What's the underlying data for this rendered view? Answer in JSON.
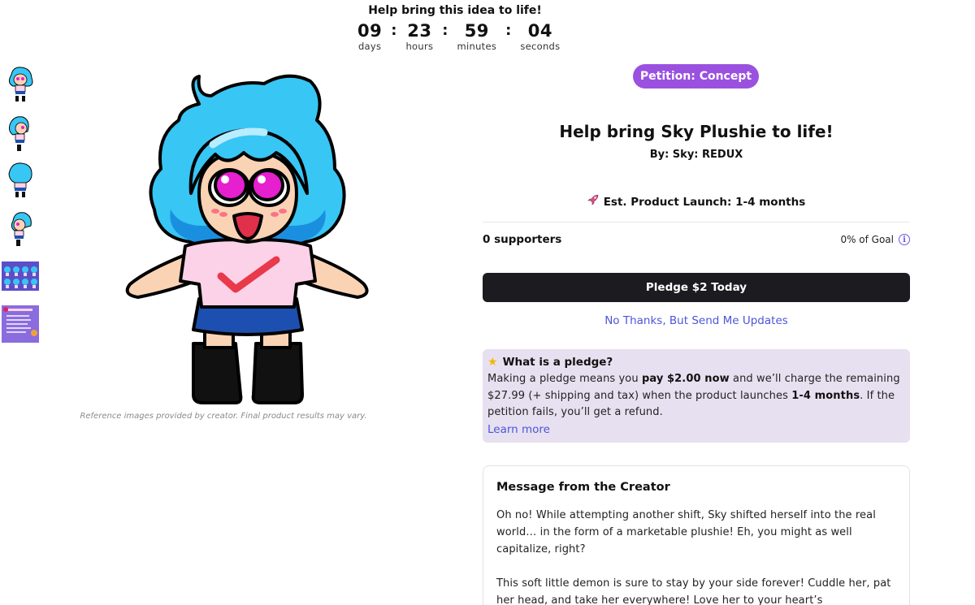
{
  "countdown": {
    "title": "Help bring this idea to life!",
    "units": [
      {
        "value": "09",
        "label": "days"
      },
      {
        "value": "23",
        "label": "hours"
      },
      {
        "value": "59",
        "label": "minutes"
      },
      {
        "value": "04",
        "label": "seconds"
      }
    ],
    "separator": ":"
  },
  "gallery": {
    "thumbnails": [
      "plushie-front",
      "plushie-side",
      "plushie-back",
      "plushie-side-2",
      "plushie-lineup",
      "info-sheet"
    ],
    "caption": "Reference images provided by creator. Final product results may vary."
  },
  "product": {
    "badge": "Petition: Concept",
    "title": "Help bring Sky Plushie to life!",
    "byline": "By: Sky: REDUX",
    "launch_icon": "rocket-icon",
    "launch": "Est. Product Launch: 1-4 months",
    "supporters": "0 supporters",
    "goal": "0% of Goal",
    "goal_progress_percent": 0,
    "info_icon": "i",
    "pledge_button": "Pledge $2 Today",
    "updates_link": "No Thanks, But Send Me Updates"
  },
  "pledge_info": {
    "icon": "star-icon",
    "heading": "What is a pledge?",
    "text_1": "Making a pledge means you ",
    "bold_1": "pay $2.00 now",
    "text_2": " and we’ll charge the remaining $27.99 (+ shipping and tax) when the product launches ",
    "bold_2": "1-4 months",
    "text_3": ". If the petition fails, you’ll get a refund.",
    "learn_more": "Learn more"
  },
  "creator": {
    "heading": "Message from the Creator",
    "paragraphs": [
      "Oh no! While attempting another shift, Sky shifted herself into the real world… in the form of a marketable plushie! Eh, you might as well capitalize, right?",
      "This soft little demon is sure to stay by your side forever! Cuddle her, pat her head, and take her everywhere! Love her to your heart’s"
    ]
  },
  "colors": {
    "badge": "#9b51e0",
    "button": "#1c1c20",
    "link": "#4c55d8",
    "info_bg": "#e7e0f0",
    "hair": "#38c6f4",
    "eyes": "#e61fcf",
    "shirt": "#fcd2e8",
    "skirt": "#1d4fb0"
  }
}
